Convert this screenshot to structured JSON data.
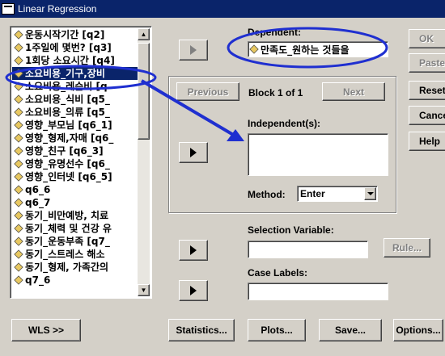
{
  "window": {
    "title": "Linear Regression"
  },
  "variables": [
    "운동시작기간 [q2]",
    "1주일에 몇번? [q3]",
    "1회당 소요시간 [q4]",
    "소요비용_기구,장비",
    "소요비용_레슨비 [q",
    "소요비용_식비 [q5_",
    "소요비용_의류 [q5_",
    "영향_부모님 [q6_1]",
    "영향_형제,자매 [q6_",
    "영향_친구 [q6_3]",
    "영향_유명선수 [q6_",
    "영향_인터넷 [q6_5]",
    "q6_6",
    "q6_7",
    "동기_비만예방, 치료",
    "동기_체력 및 건강 유",
    "동기_운동부족 [q7_",
    "동기_스트레스 해소",
    "동기_형제, 가족간의",
    "q7_6"
  ],
  "selected_variable_index": 3,
  "dependent": {
    "label": "Dependent:",
    "value": "만족도_원하는 것들을"
  },
  "block": {
    "previous_label": "Previous",
    "next_label": "Next",
    "text": "Block 1 of 1"
  },
  "independent": {
    "label": "Independent(s):"
  },
  "method": {
    "label": "Method:",
    "value": "Enter"
  },
  "selection_variable": {
    "label": "Selection Variable:",
    "rule_label": "Rule..."
  },
  "case_labels": {
    "label": "Case Labels:"
  },
  "side_buttons": {
    "ok": "OK",
    "paste": "Paste",
    "reset": "Reset",
    "cancel": "Cancel",
    "help": "Help"
  },
  "bottom_buttons": {
    "wls": "WLS >>",
    "statistics": "Statistics...",
    "plots": "Plots...",
    "save": "Save...",
    "options": "Options..."
  },
  "annotation": {
    "ellipse_color": "#1f2fd0",
    "arrow_color": "#1f2fd0"
  }
}
